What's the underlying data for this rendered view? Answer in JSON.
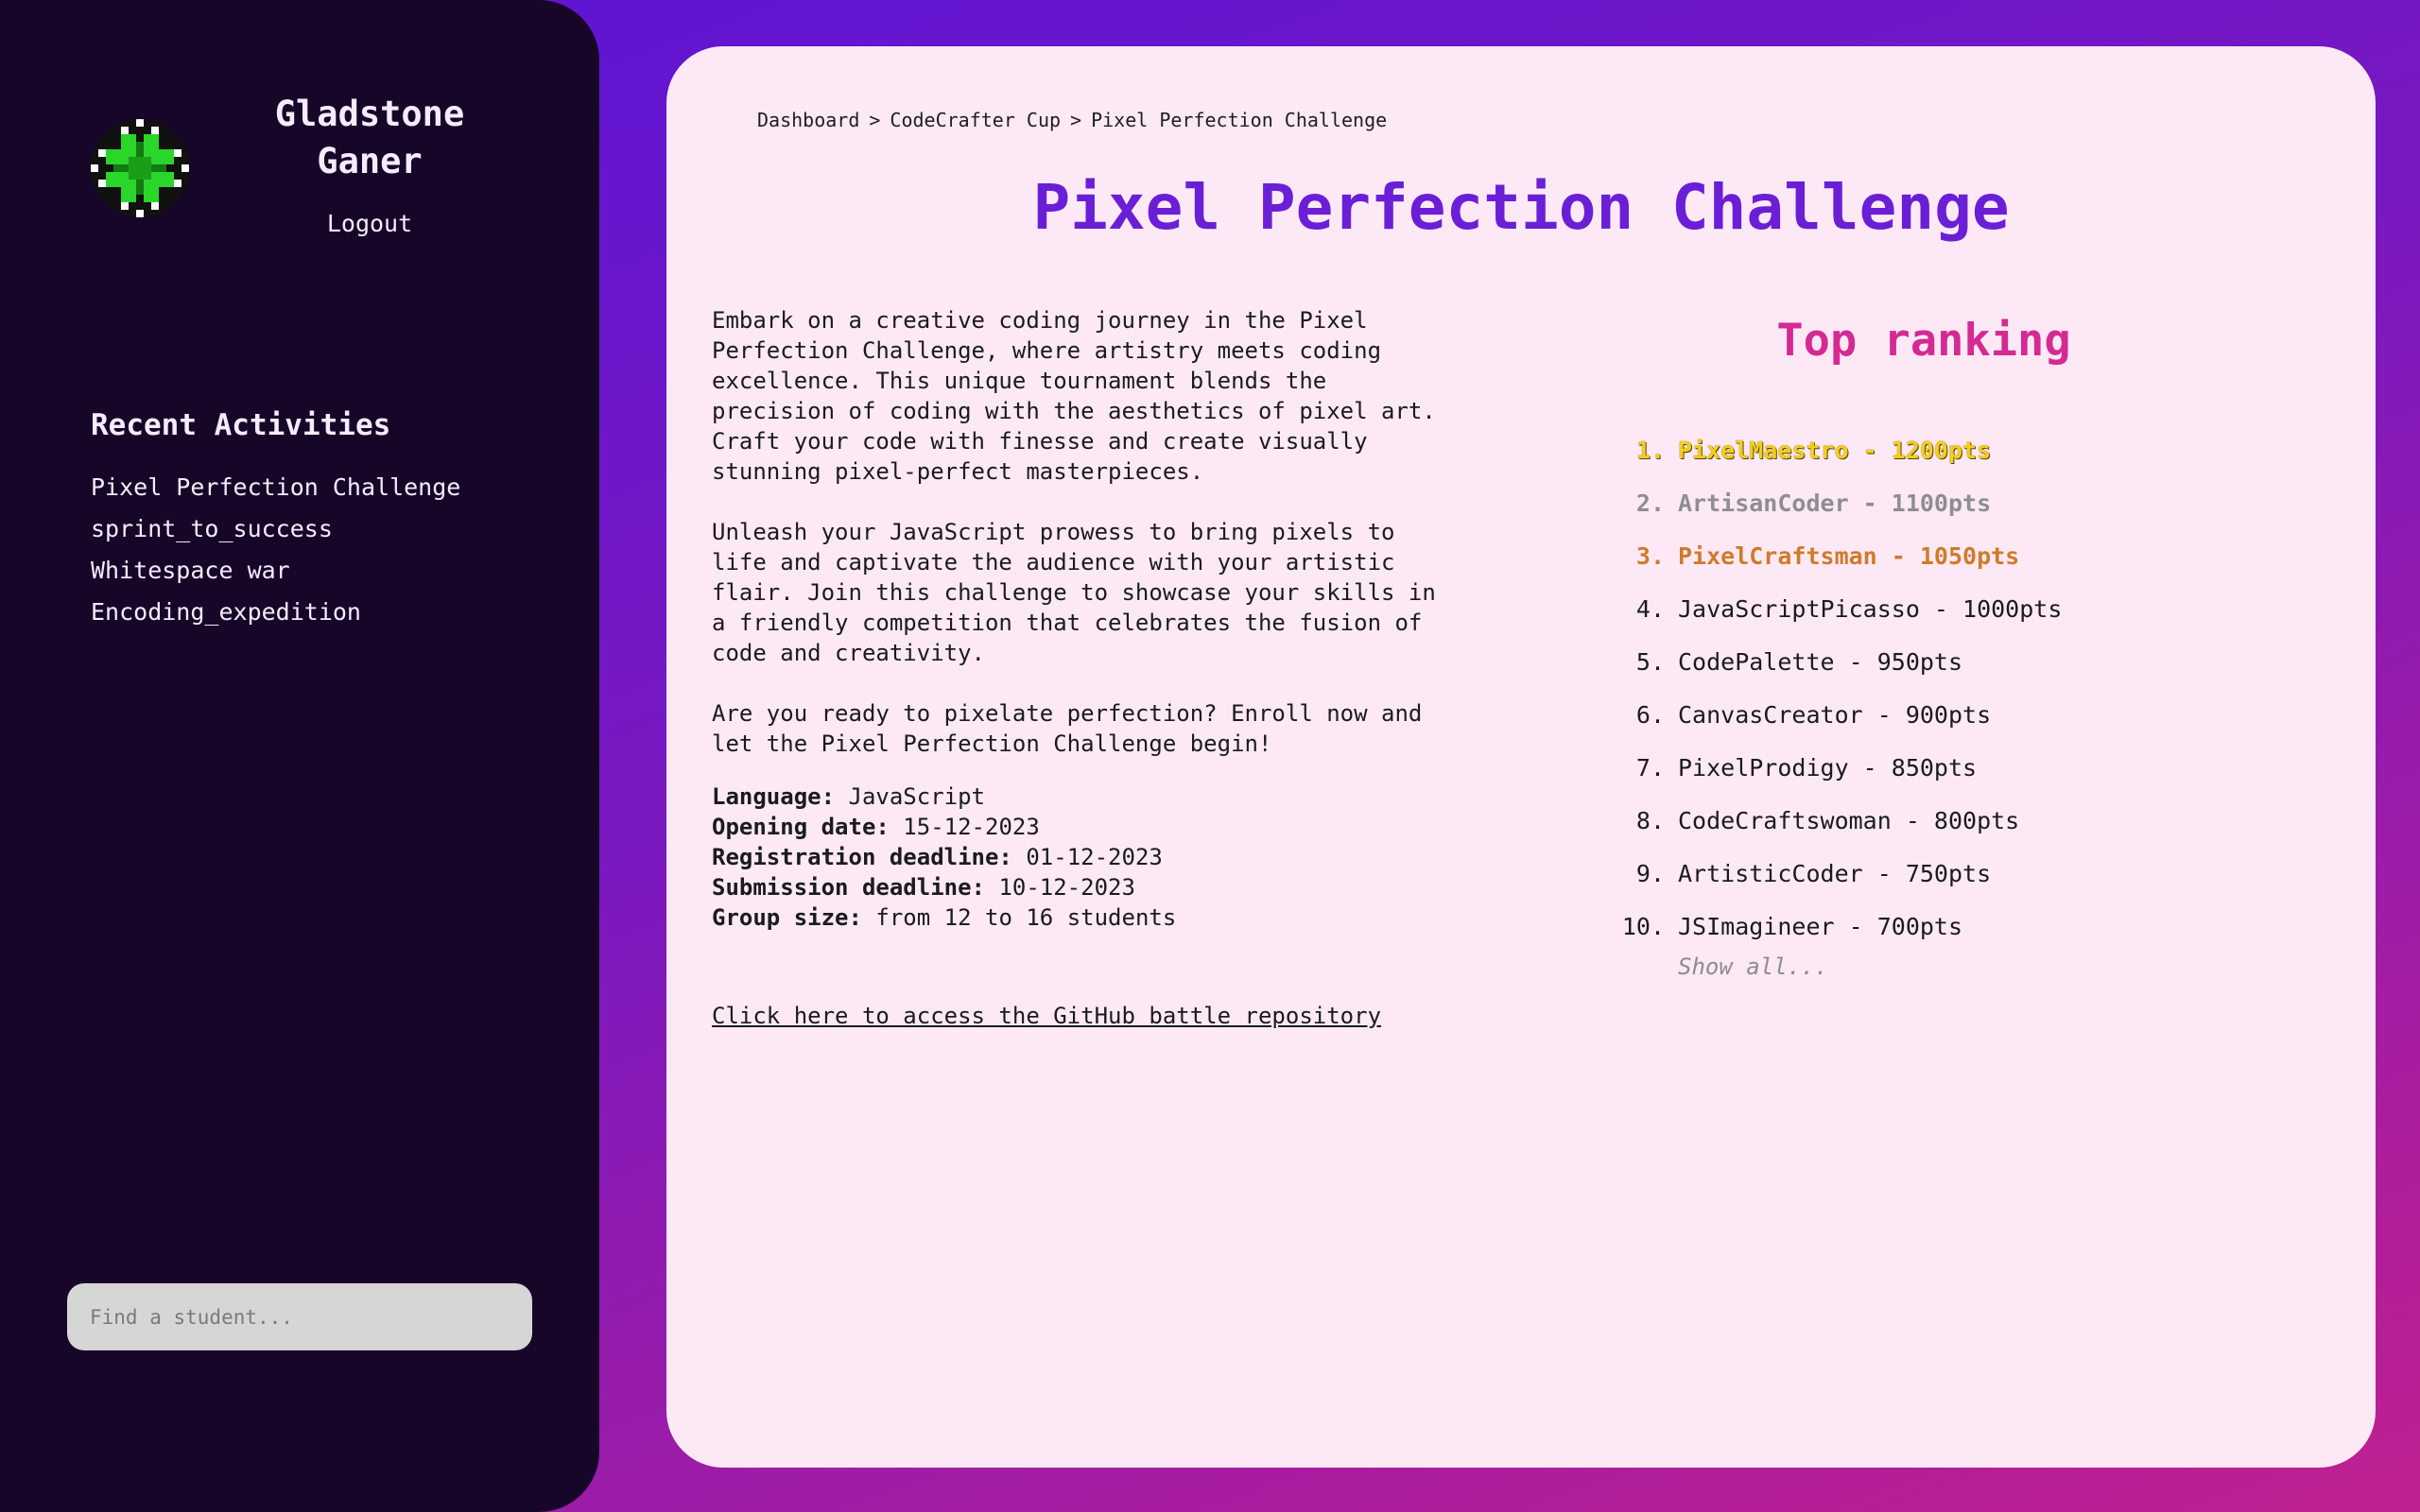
{
  "sidebar": {
    "user_name": "Gladstone Ganer",
    "logout_label": "Logout",
    "recent_title": "Recent Activities",
    "recent_items": [
      "Pixel Perfection Challenge",
      "sprint_to_success",
      "Whitespace war",
      "Encoding_expedition"
    ],
    "search_placeholder": "Find a student..."
  },
  "main": {
    "breadcrumb": [
      "Dashboard",
      "CodeCrafter Cup",
      "Pixel Perfection Challenge"
    ],
    "breadcrumb_separator": ">",
    "title": "Pixel Perfection Challenge",
    "description": [
      "Embark on a creative coding journey in the Pixel Perfection Challenge, where artistry meets coding excellence. This unique tournament blends the precision of coding with the aesthetics of pixel art. Craft your code with finesse and create visually stunning pixel-perfect masterpieces.",
      "Unleash your JavaScript prowess to bring pixels to life and captivate the audience with your artistic flair. Join this challenge to showcase your skills in a friendly competition that celebrates the fusion of code and creativity.",
      "Are you ready to pixelate perfection? Enroll now and let the Pixel Perfection Challenge begin!"
    ],
    "details": {
      "language_label": "Language:",
      "language": "JavaScript",
      "opening_label": "Opening date:",
      "opening": "15-12-2023",
      "registration_label": "Registration deadline:",
      "registration": "01-12-2023",
      "submission_label": "Submission deadline:",
      "submission": "10-12-2023",
      "group_label": "Group size:",
      "group": "from 12 to 16 students"
    },
    "repo_link": "Click here to access the GitHub battle repository",
    "ranking_title": "Top ranking",
    "ranking": [
      {
        "num": "1.",
        "text": "PixelMaestro - 1200pts"
      },
      {
        "num": "2.",
        "text": "ArtisanCoder - 1100pts"
      },
      {
        "num": "3.",
        "text": "PixelCraftsman - 1050pts"
      },
      {
        "num": "4.",
        "text": "JavaScriptPicasso - 1000pts"
      },
      {
        "num": "5.",
        "text": "CodePalette - 950pts"
      },
      {
        "num": "6.",
        "text": "CanvasCreator - 900pts"
      },
      {
        "num": "7.",
        "text": "PixelProdigy - 850pts"
      },
      {
        "num": "8.",
        "text": "CodeCraftswoman - 800pts"
      },
      {
        "num": "9.",
        "text": "ArtisticCoder - 750pts"
      },
      {
        "num": "10.",
        "text": "JSImagineer - 700pts"
      }
    ],
    "show_all": "Show all..."
  },
  "colors": {
    "sidebar_bg": "#180629",
    "card_bg": "#fde9f6",
    "title": "#6a1fd6",
    "ranking_title": "#d42a92",
    "gold": "#f2cf1c",
    "silver": "#8e8e8e",
    "bronze": "#d07a2a"
  },
  "icons": {
    "avatar": "pixel-clover-avatar-icon"
  }
}
